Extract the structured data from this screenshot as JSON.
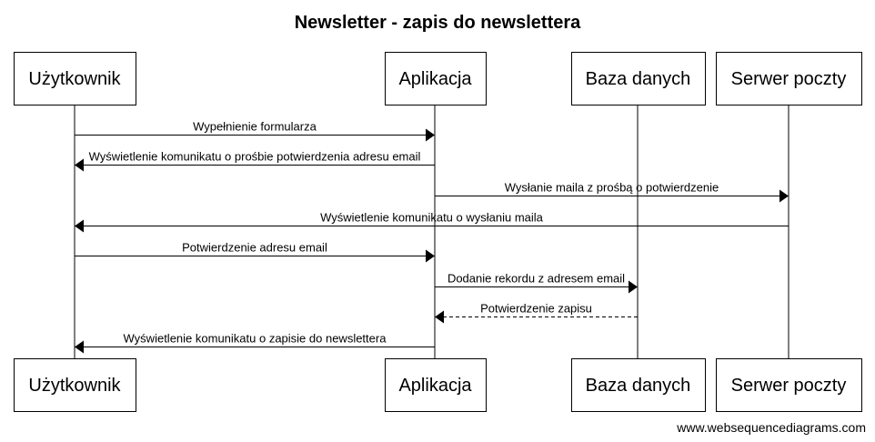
{
  "diagram": {
    "title": "Newsletter - zapis do newslettera",
    "participants": [
      {
        "id": "user",
        "label": "Użytkownik"
      },
      {
        "id": "app",
        "label": "Aplikacja"
      },
      {
        "id": "db",
        "label": "Baza danych"
      },
      {
        "id": "mail",
        "label": "Serwer poczty"
      }
    ],
    "messages": [
      {
        "from": "user",
        "to": "app",
        "label": "Wypełnienie formularza",
        "style": "solid"
      },
      {
        "from": "app",
        "to": "user",
        "label": "Wyświetlenie komunikatu o prośbie potwierdzenia adresu email",
        "style": "solid"
      },
      {
        "from": "app",
        "to": "mail",
        "label": "Wysłanie maila z prośbą o potwierdzenie",
        "style": "solid"
      },
      {
        "from": "mail",
        "to": "user",
        "label": "Wyświetlenie komunikatu o wysłaniu maila",
        "style": "solid"
      },
      {
        "from": "user",
        "to": "app",
        "label": "Potwierdzenie adresu email",
        "style": "solid"
      },
      {
        "from": "app",
        "to": "db",
        "label": "Dodanie rekordu z adresem email",
        "style": "solid"
      },
      {
        "from": "db",
        "to": "app",
        "label": "Potwierdzenie zapisu",
        "style": "dashed"
      },
      {
        "from": "app",
        "to": "user",
        "label": "Wyświetlenie komunikatu o zapisie do newslettera",
        "style": "solid"
      }
    ],
    "watermark": "www.websequencediagrams.com"
  }
}
